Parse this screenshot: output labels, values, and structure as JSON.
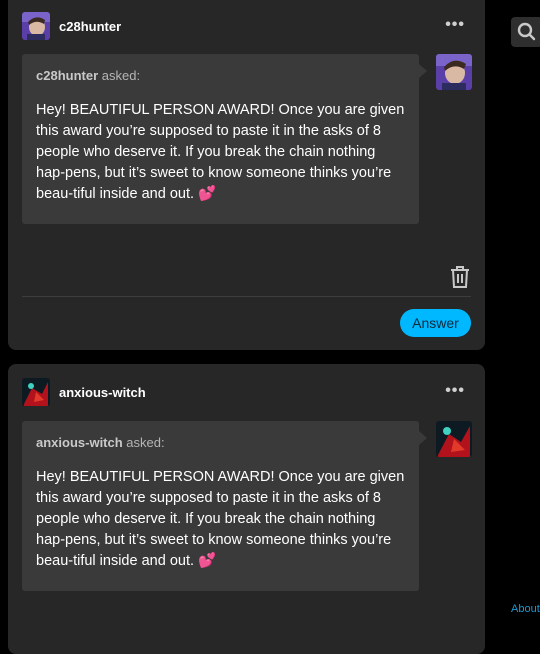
{
  "posts": [
    {
      "username": "c28hunter",
      "asker": "c28hunter",
      "asked_suffix": " asked:",
      "question": "Hey! BEAUTIFUL PERSON AWARD! Once you are given this award you’re supposed to paste it in the asks of 8 people who deserve it. If you break the chain nothing hap-pens, but it’s sweet to know someone thinks you’re beau-tiful inside and out.",
      "heart": "💕",
      "more": "•••",
      "answer_label": "Answer"
    },
    {
      "username": "anxious-witch",
      "asker": "anxious-witch",
      "asked_suffix": " asked:",
      "question": "Hey! BEAUTIFUL PERSON AWARD! Once you are given this award you’re supposed to paste it in the asks of 8 people who deserve it. If you break the chain nothing hap-pens, but it’s sweet to know someone thinks you’re beau-tiful inside and out.",
      "heart": "💕",
      "more": "•••"
    }
  ],
  "sidebar": {
    "about": "About"
  },
  "icons": {
    "search": "search-icon",
    "trash": "trash-icon",
    "more": "more-options-icon"
  },
  "colors": {
    "card": "#272727",
    "bubble": "#3a3a3a",
    "accent": "#00b8ff",
    "link": "#1c9ad6"
  }
}
